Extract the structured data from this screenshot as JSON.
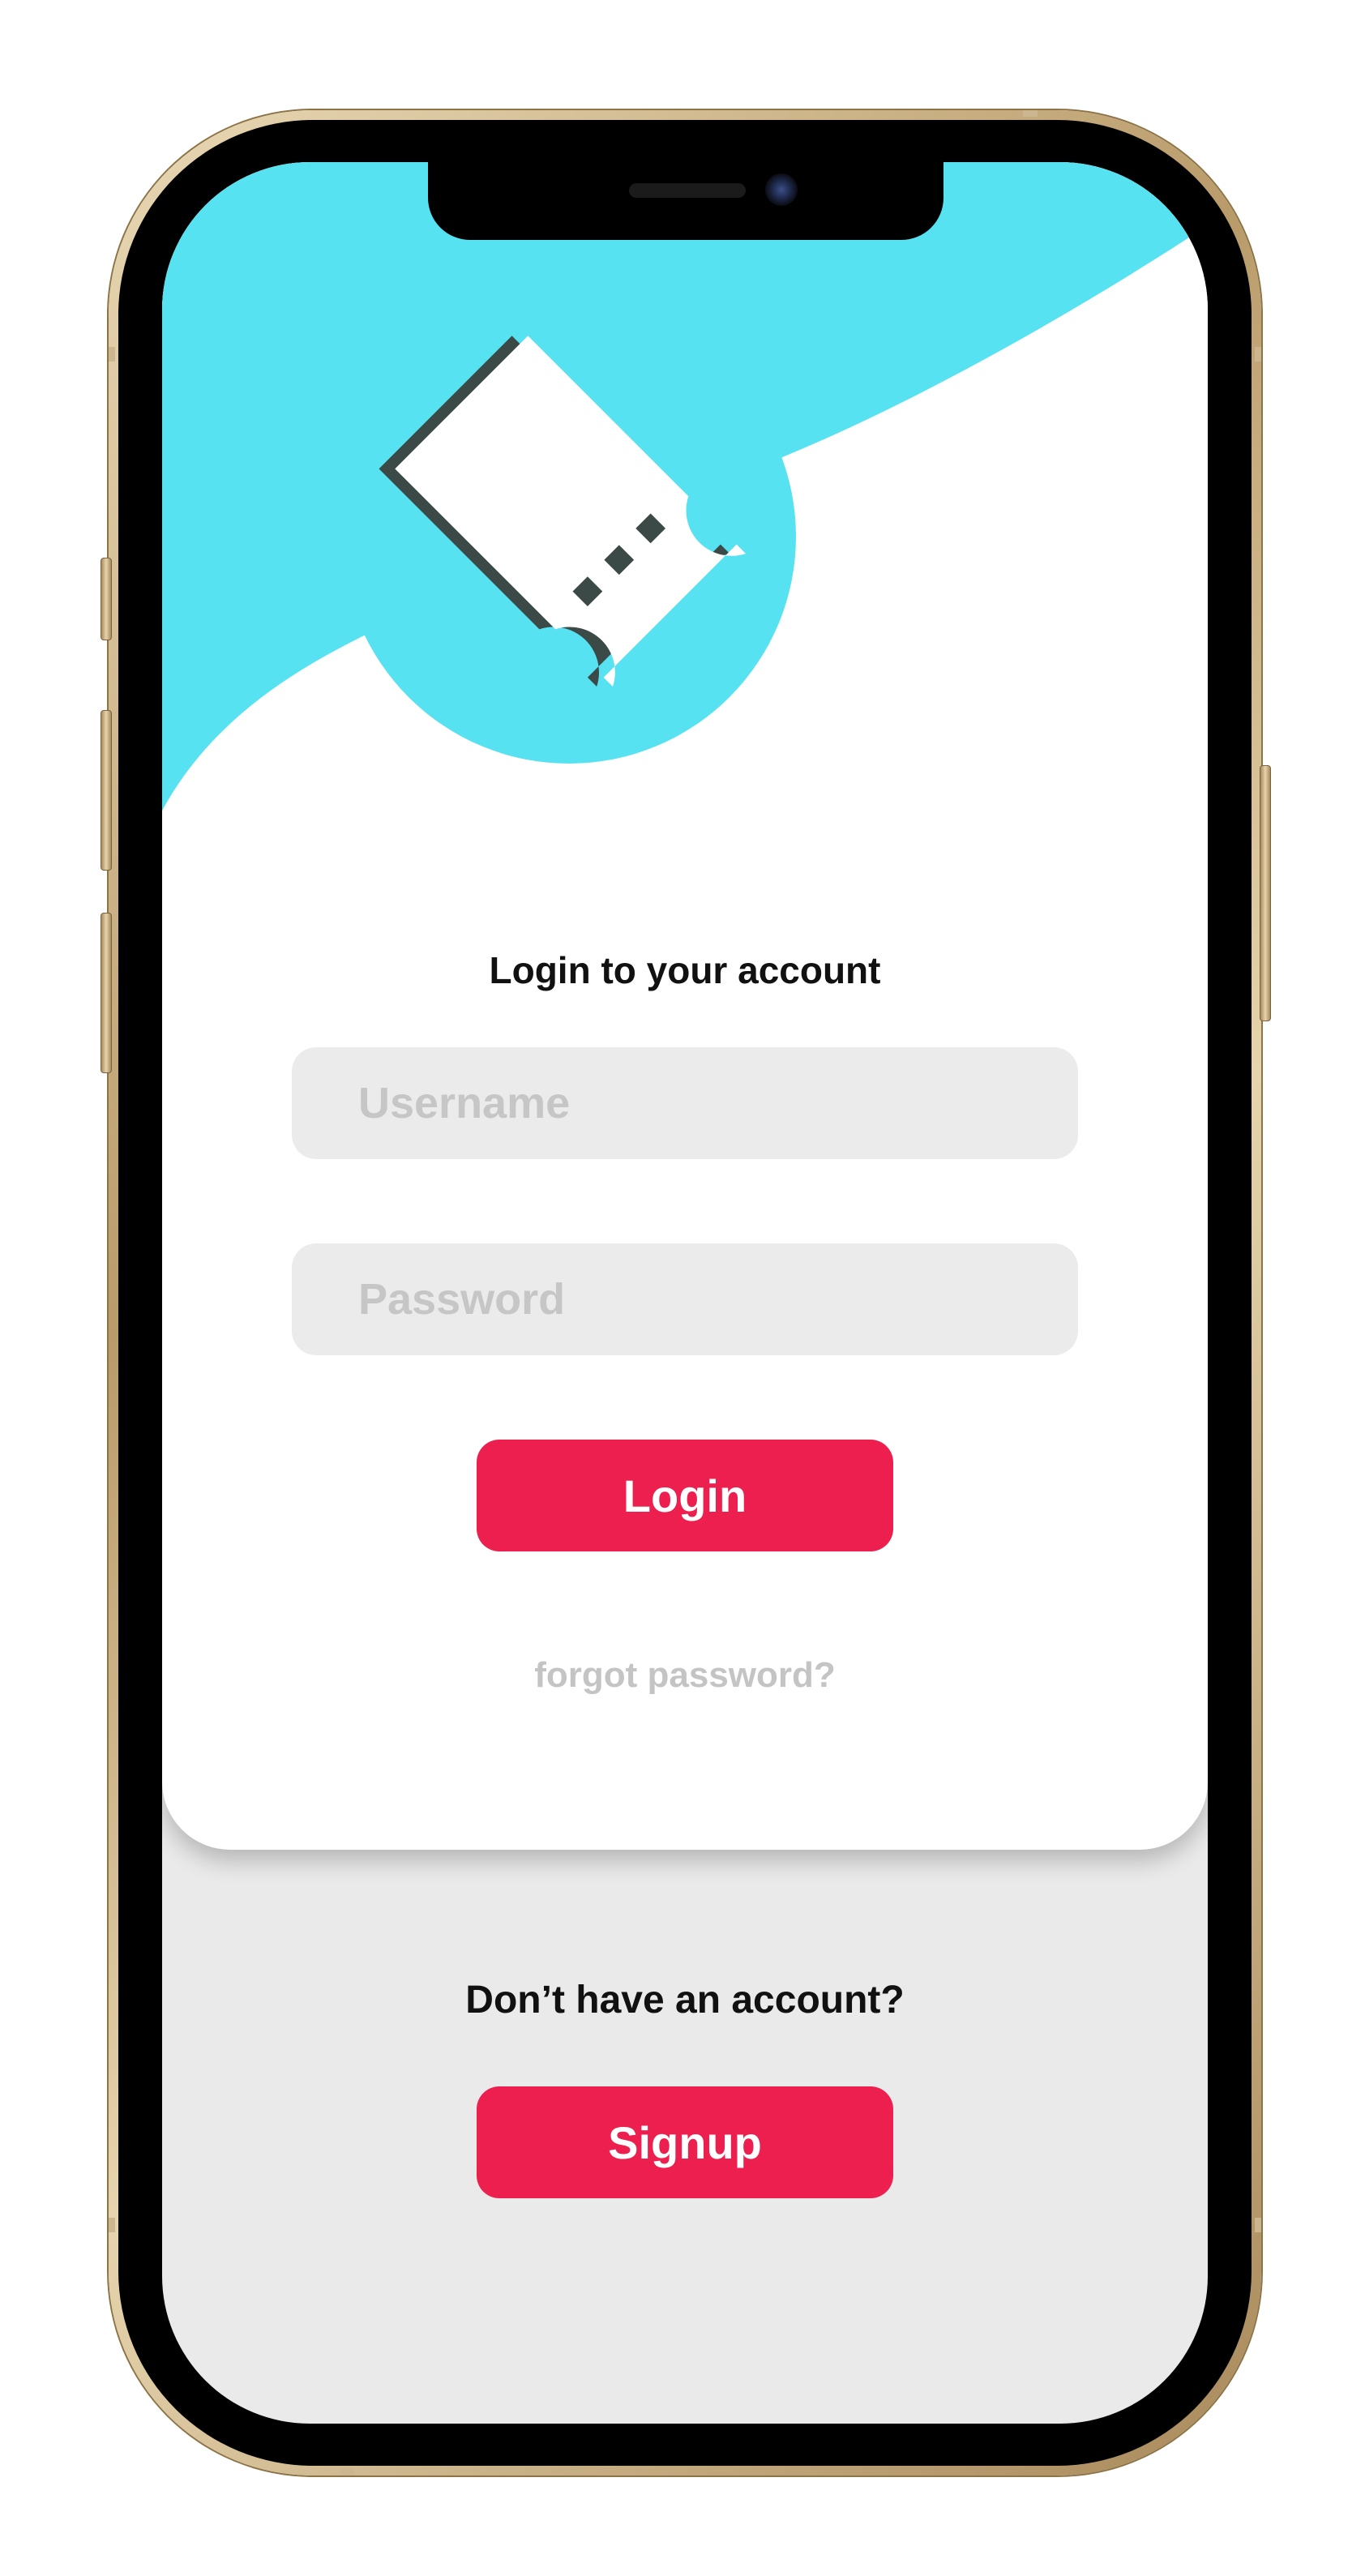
{
  "login": {
    "title": "Login to your account",
    "username_placeholder": "Username",
    "password_placeholder": "Password",
    "login_label": "Login",
    "forgot_label": "forgot password?"
  },
  "signup": {
    "prompt": "Don’t have an account?",
    "signup_label": "Signup"
  },
  "icons": {
    "hero": "ticket-icon"
  },
  "colors": {
    "accent": "#ec1f4e",
    "hero_background": "#56e2f0",
    "input_background": "#ebebeb",
    "lower_background": "#eaeaea",
    "ticket_fill": "#ffffff",
    "ticket_shadow": "#3b4a47",
    "frame_gold": "#c9b28a"
  }
}
